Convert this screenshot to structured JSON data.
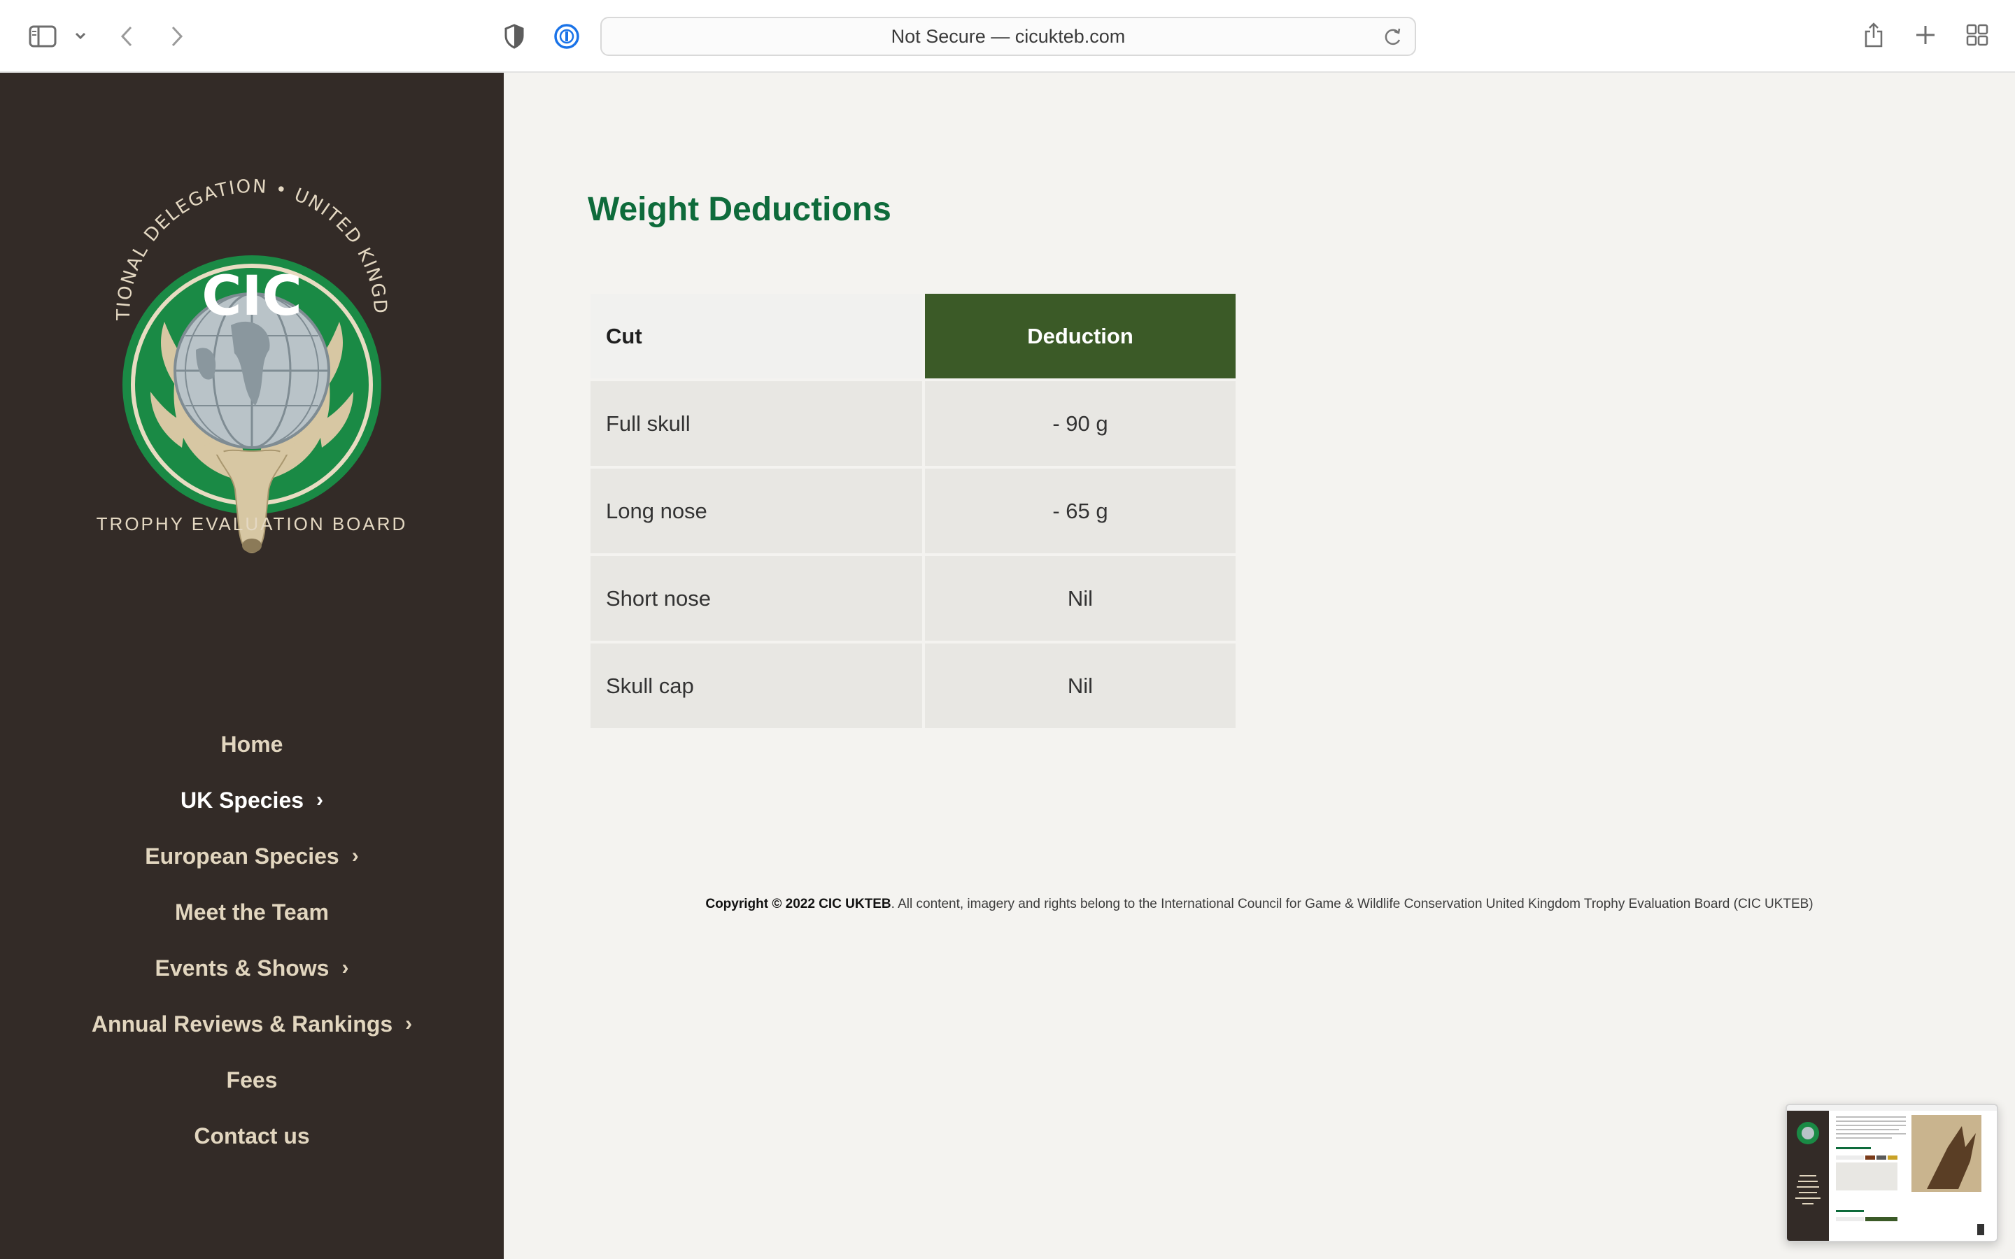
{
  "browser": {
    "address_text": "Not Secure — cicukteb.com",
    "icons": [
      "sidebar-icon",
      "chevron-down-icon",
      "back-icon",
      "forward-icon",
      "shield-icon",
      "password-manager-icon",
      "reload-icon",
      "share-icon",
      "new-tab-icon",
      "tab-overview-icon"
    ]
  },
  "logo": {
    "ring_text": "NATIONAL DELEGATION • UNITED KINGDOM",
    "monogram": "CIC",
    "caption": "TROPHY EVALUATION BOARD"
  },
  "nav": {
    "items": [
      {
        "label": "Home",
        "has_submenu": false,
        "active": false
      },
      {
        "label": "UK Species",
        "has_submenu": true,
        "active": true
      },
      {
        "label": "European Species",
        "has_submenu": true,
        "active": false
      },
      {
        "label": "Meet the Team",
        "has_submenu": false,
        "active": false
      },
      {
        "label": "Events & Shows",
        "has_submenu": true,
        "active": false
      },
      {
        "label": "Annual Reviews & Rankings",
        "has_submenu": true,
        "active": false
      },
      {
        "label": "Fees",
        "has_submenu": false,
        "active": false
      },
      {
        "label": "Contact us",
        "has_submenu": false,
        "active": false
      }
    ]
  },
  "main": {
    "heading": "Weight Deductions",
    "table": {
      "headers": [
        "Cut",
        "Deduction"
      ],
      "rows": [
        [
          "Full skull",
          "- 90 g"
        ],
        [
          "Long nose",
          "- 65 g"
        ],
        [
          "Short nose",
          "Nil"
        ],
        [
          "Skull cap",
          "Nil"
        ]
      ]
    },
    "footer": {
      "copyright": "Copyright © 2022 CIC UKTEB",
      "text": ". All content, imagery and rights belong to the International Council for Game & Wildlife Conservation United Kingdom Trophy Evaluation Board (CIC UKTEB)"
    }
  },
  "colors": {
    "sidebar_bg": "#332b27",
    "nav_text": "#e2d6bf",
    "heading_green": "#0e6b3b",
    "table_header_green": "#3b5a27",
    "page_bg": "#f4f3f0"
  }
}
